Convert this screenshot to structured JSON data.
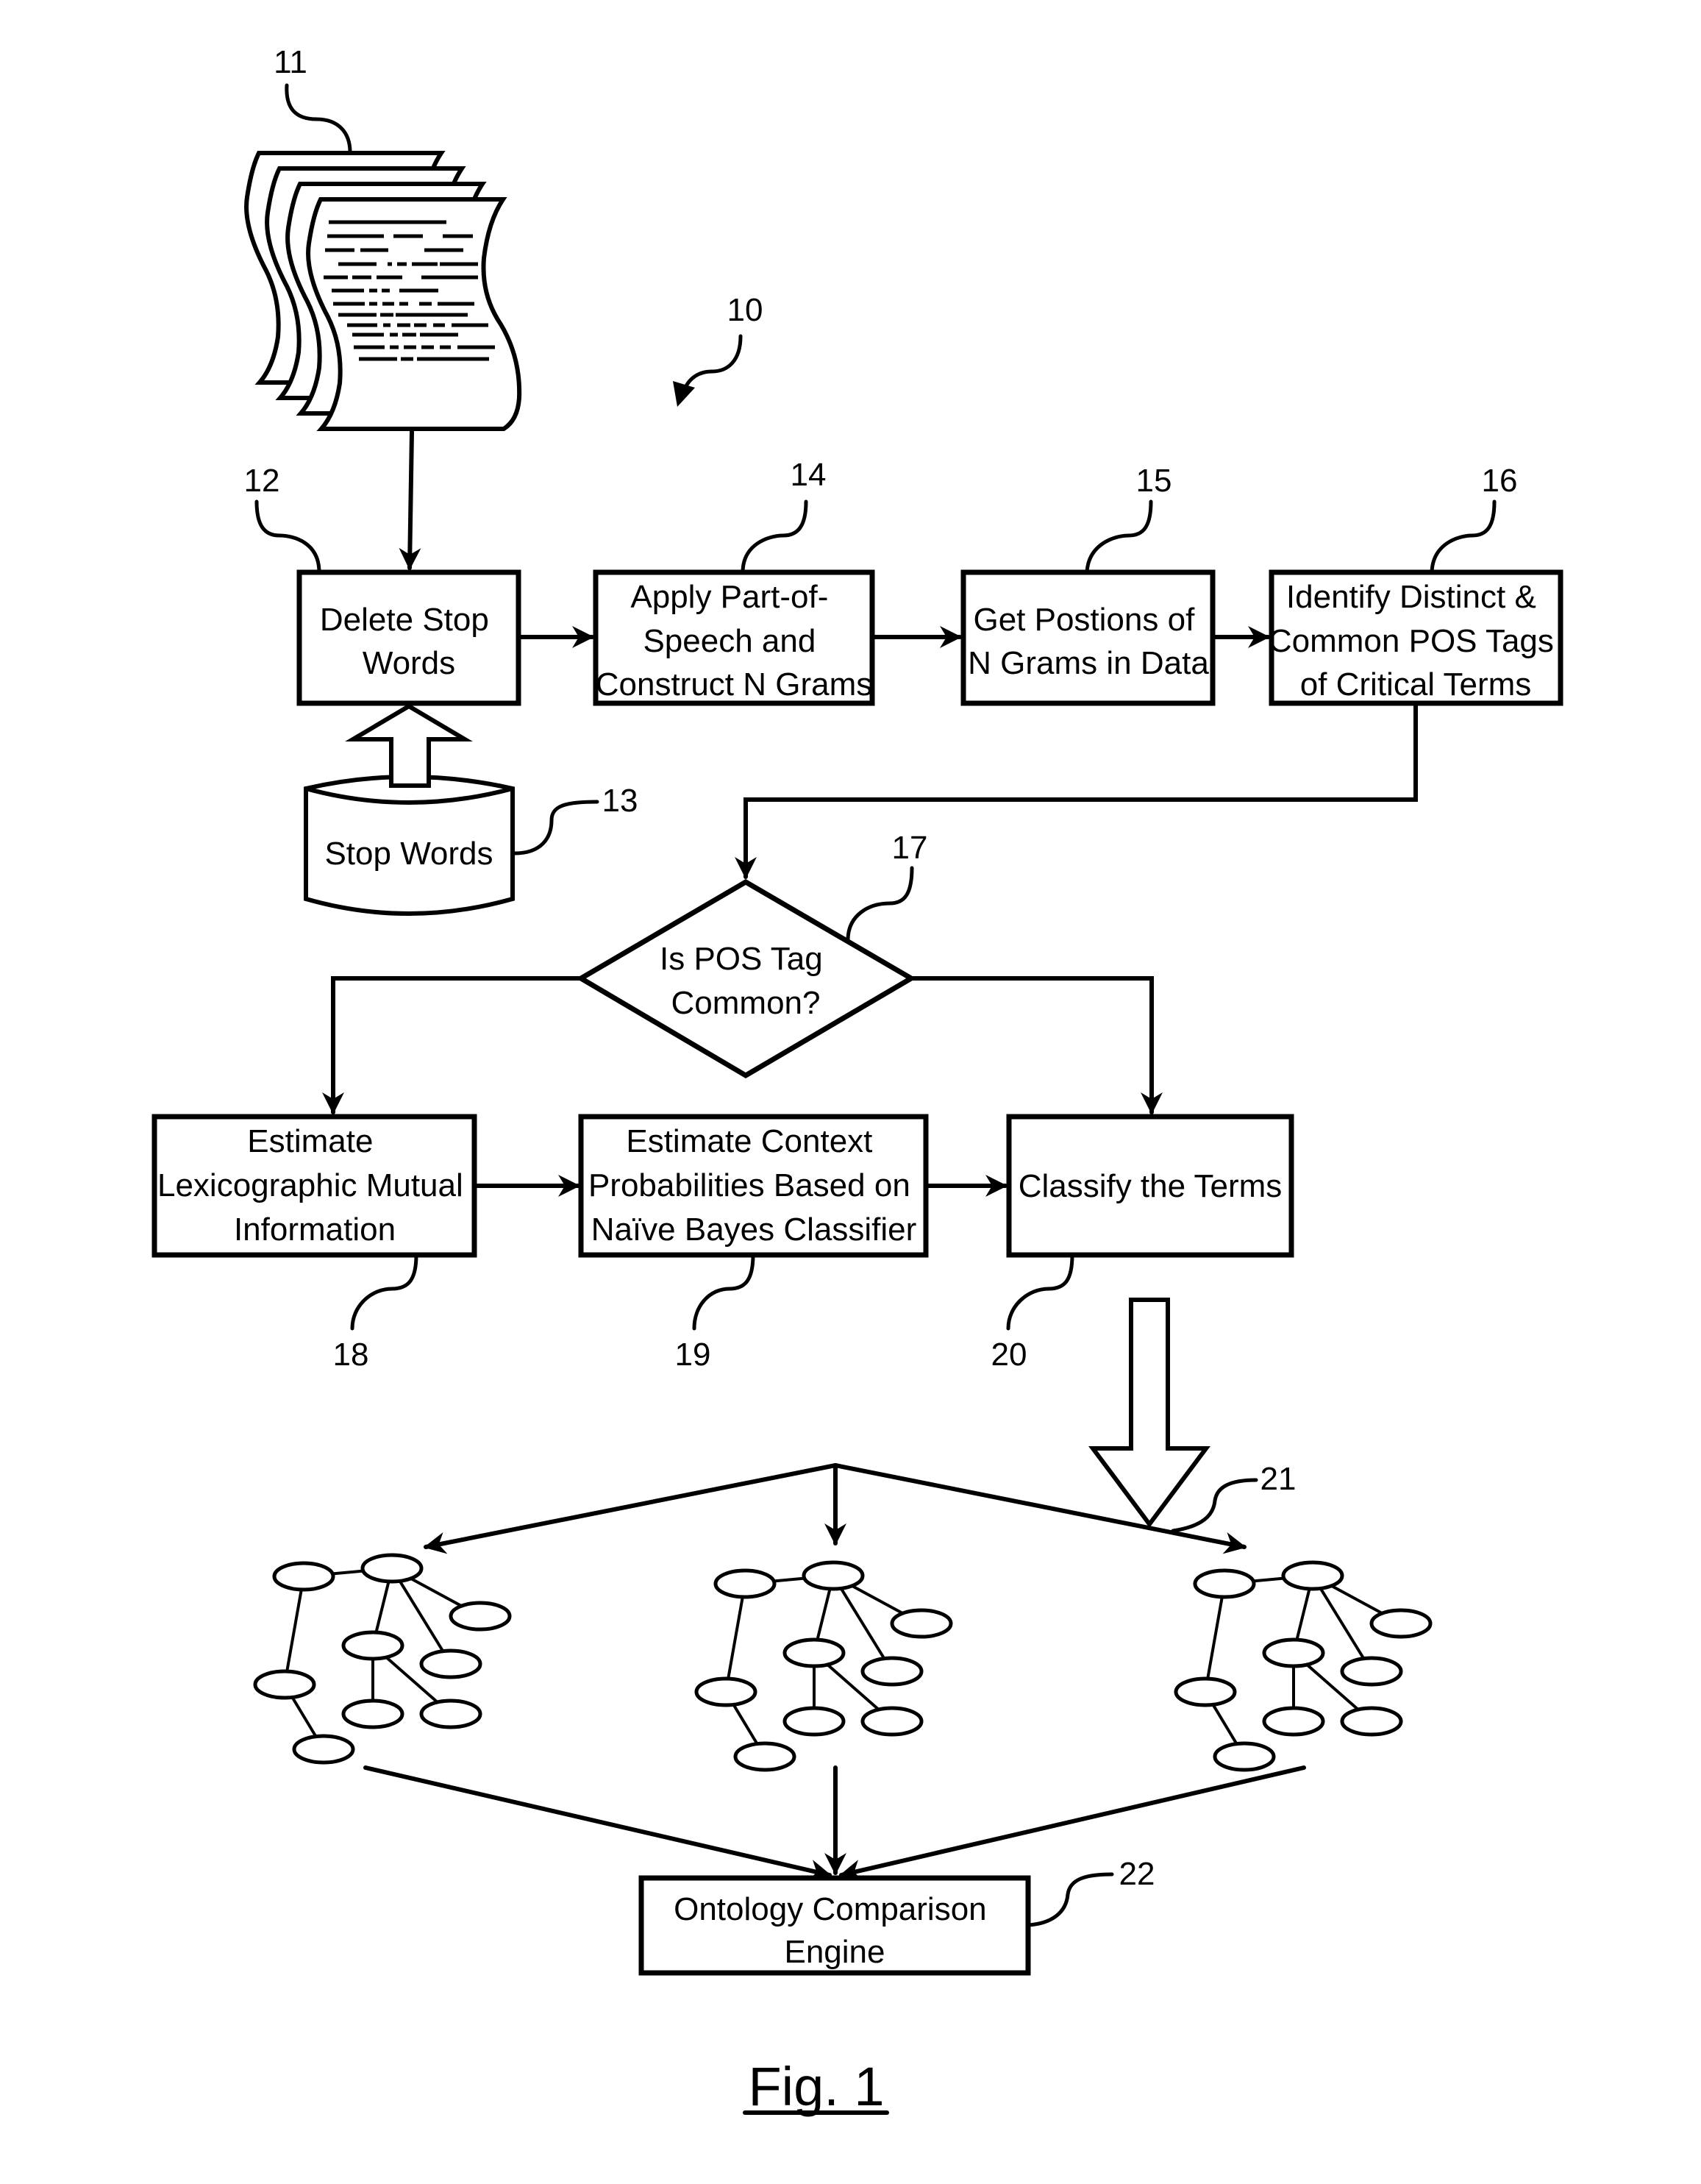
{
  "figure": {
    "title": "Fig. 1",
    "system_ref": "10"
  },
  "documents": {
    "ref": "11",
    "icon": "document-stack-icon"
  },
  "steps": {
    "delete_stop_words": {
      "ref": "12",
      "lines": [
        "Delete Stop",
        "Words"
      ]
    },
    "stop_words_db": {
      "ref": "13",
      "lines": [
        "Stop Words"
      ],
      "icon": "database-cylinder-icon"
    },
    "apply_pos": {
      "ref": "14",
      "lines": [
        "Apply Part-of-",
        "Speech and",
        "Construct N Grams"
      ]
    },
    "get_positions": {
      "ref": "15",
      "lines": [
        "Get Postions of",
        "N Grams in Data"
      ]
    },
    "identify_tags": {
      "ref": "16",
      "lines": [
        "Identify Distinct &",
        "Common POS Tags",
        "of Critical Terms"
      ]
    },
    "decision": {
      "ref": "17",
      "lines": [
        "Is POS Tag",
        "Common?"
      ]
    },
    "estimate_lmi": {
      "ref": "18",
      "lines": [
        "Estimate",
        "Lexicographic Mutual",
        "Information"
      ]
    },
    "estimate_context": {
      "ref": "19",
      "lines": [
        "Estimate Context",
        "Probabilities Based on",
        "Naïve Bayes Classifier"
      ]
    },
    "classify": {
      "ref": "20",
      "lines": [
        "Classify the Terms"
      ]
    },
    "ontologies": {
      "ref": "21",
      "count": 3,
      "icon": "tree-graph-icon"
    },
    "comparison_engine": {
      "ref": "22",
      "lines": [
        "Ontology Comparison",
        "Engine"
      ]
    }
  }
}
